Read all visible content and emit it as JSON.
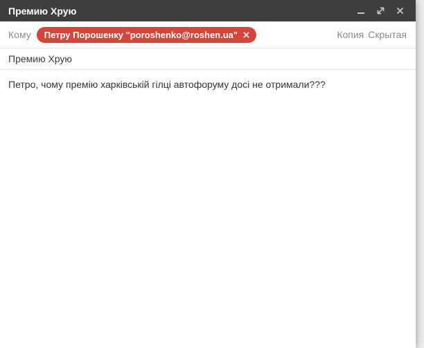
{
  "window": {
    "title": "Премию Хрую"
  },
  "titlebar_icons": {
    "minimize": "horizontal-bar",
    "expand": "diagonal-resize-arrows",
    "close": "x"
  },
  "recipients": {
    "to_label": "Кому",
    "chip": {
      "text": "Петру Порошенку \"poroshenko@roshen.ua\"",
      "remove_icon": "x"
    },
    "cc_label": "Копия",
    "bcc_label": "Скрытая"
  },
  "subject": {
    "value": "Премию Хрую"
  },
  "body": {
    "text": "Петро, чому премію харківській гілці автофоруму досі не отримали???"
  },
  "colors": {
    "titlebar_bg": "#3e3e3e",
    "titlebar_text": "#ffffff",
    "control_icon": "#c9c9c9",
    "chip_bg": "#d6453c",
    "chip_text": "#ffffff",
    "muted_text": "#8a8a8a",
    "body_text": "#333333",
    "divider": "#e3e3e3",
    "window_bg": "#ffffff",
    "page_bg": "#ededed"
  }
}
